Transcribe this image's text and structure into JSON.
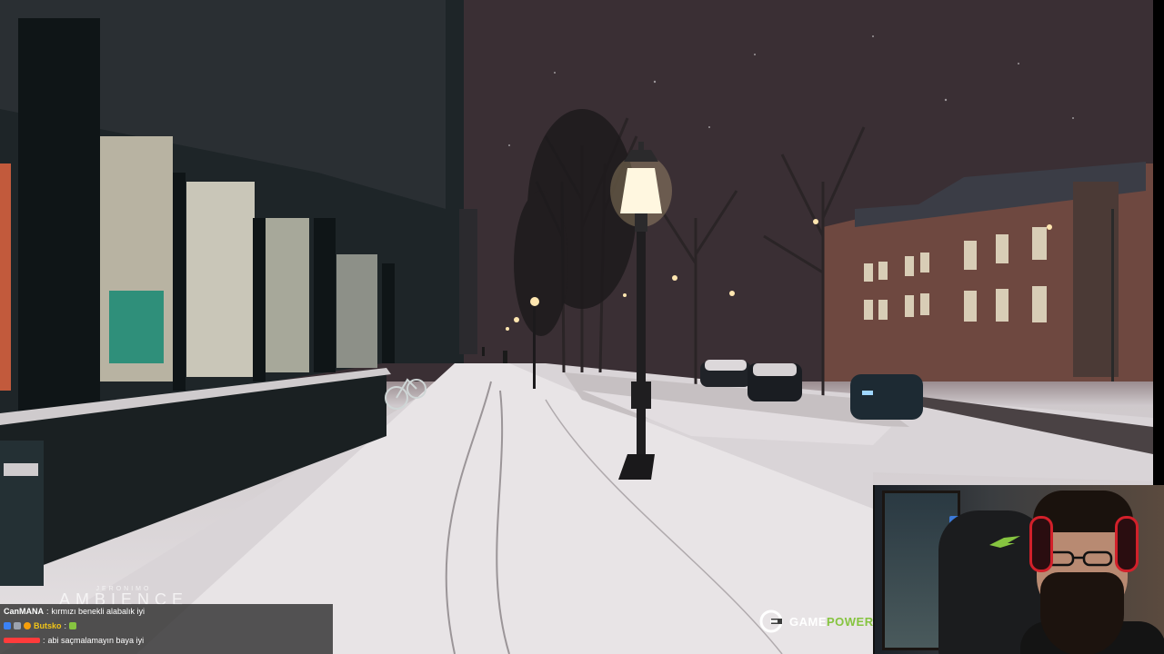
{
  "stream": {
    "scene_icon": "snowy-city-night-scene"
  },
  "overlay": {
    "branding": {
      "gamepower_prefix": "GAME",
      "gamepower_suffix": "POWER",
      "ambience_top": "JERONIMO",
      "ambience_bottom": "AMBIENCE"
    },
    "webcam": {
      "headset_color": "#d2202a",
      "chair_logo_color": "#86c440"
    }
  },
  "chat": {
    "messages": [
      {
        "user": "CanMANA",
        "user_color": "#ffffff",
        "text": "kırmızı benekli alabalık iyi"
      },
      {
        "user": "Butsko",
        "user_color": "#f0c419",
        "text": ""
      },
      {
        "user": "",
        "user_color": "#ff3b3b",
        "text": "abi saçmalamayın baya iyi"
      }
    ]
  }
}
